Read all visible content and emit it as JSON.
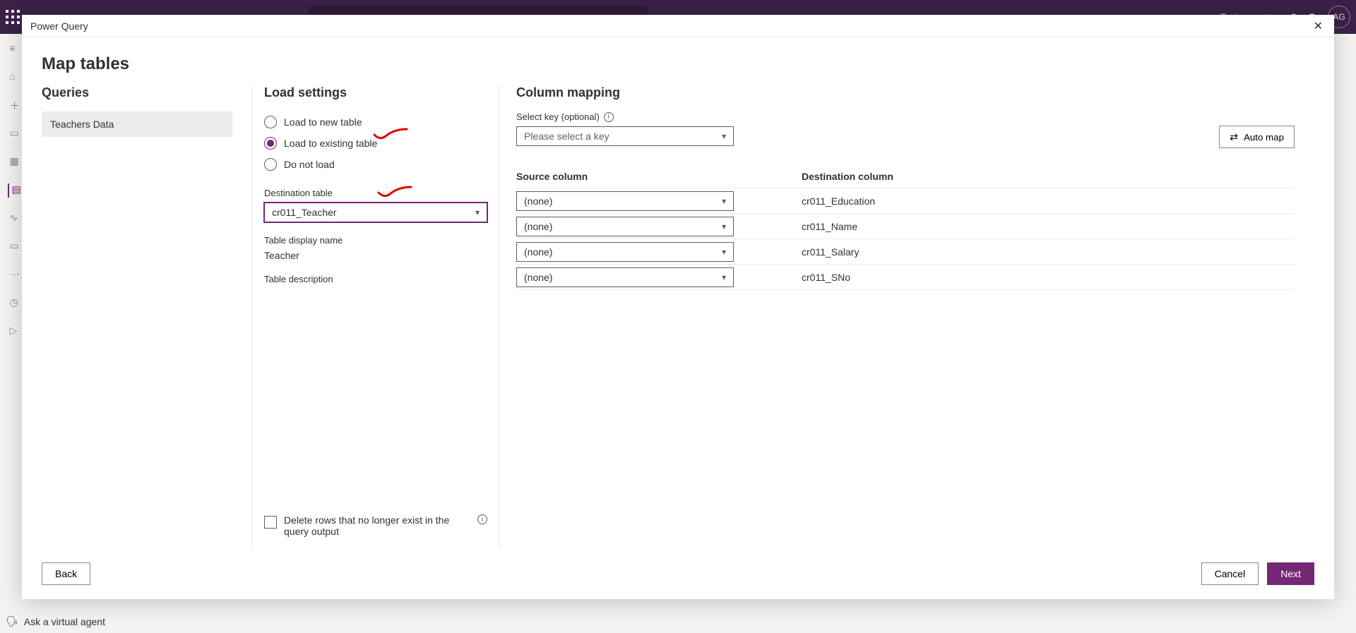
{
  "top": {
    "environment_label": "Environment",
    "avatar_initials": "AG"
  },
  "ask_agent": "Ask a virtual agent",
  "modal": {
    "window_title": "Power Query",
    "page_title": "Map tables"
  },
  "queries": {
    "heading": "Queries",
    "items": [
      "Teachers Data"
    ]
  },
  "load_settings": {
    "heading": "Load settings",
    "option_new": "Load to new table",
    "option_existing": "Load to existing table",
    "option_none": "Do not load",
    "selected": "existing",
    "dest_table_label": "Destination table",
    "dest_table_value": "cr011_Teacher",
    "display_name_label": "Table display name",
    "display_name_value": "Teacher",
    "description_label": "Table description",
    "description_value": "",
    "delete_rows_label": "Delete rows that no longer exist in the query output"
  },
  "column_mapping": {
    "heading": "Column mapping",
    "key_label": "Select key (optional)",
    "key_placeholder": "Please select a key",
    "automap_label": "Auto map",
    "source_header": "Source column",
    "dest_header": "Destination column",
    "rows": [
      {
        "source": "(none)",
        "dest": "cr011_Education"
      },
      {
        "source": "(none)",
        "dest": "cr011_Name"
      },
      {
        "source": "(none)",
        "dest": "cr011_Salary"
      },
      {
        "source": "(none)",
        "dest": "cr011_SNo"
      }
    ]
  },
  "footer": {
    "back": "Back",
    "cancel": "Cancel",
    "next": "Next"
  }
}
